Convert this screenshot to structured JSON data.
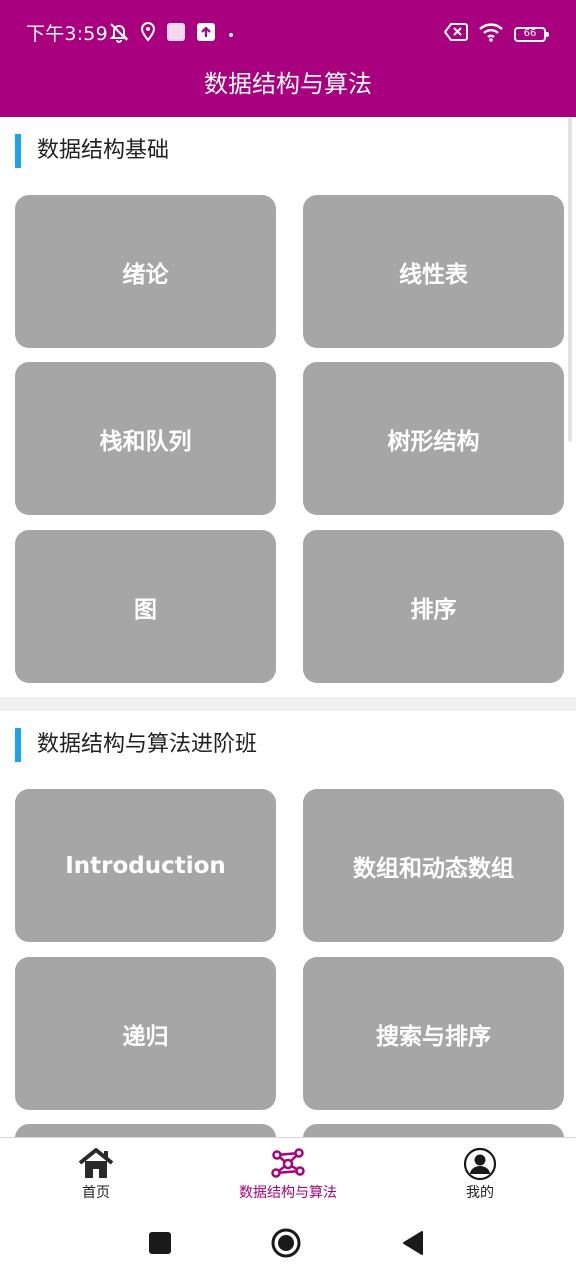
{
  "status_bar": {
    "time": "下午3:59",
    "battery": "66",
    "background": "#A8007E"
  },
  "title_bar": {
    "title": "数据结构与算法"
  },
  "sections": [
    {
      "title": "数据结构基础",
      "tiles": [
        "绪论",
        "线性表",
        "栈和队列",
        "树形结构",
        "图",
        "排序"
      ]
    },
    {
      "title": "数据结构与算法进阶班",
      "tiles": [
        "Introduction",
        "数组和动态数组",
        "递归",
        "搜索与排序"
      ]
    }
  ],
  "bottom_nav": {
    "items": [
      {
        "label": "首页",
        "icon": "home-icon"
      },
      {
        "label": "数据结构与算法",
        "icon": "network-icon",
        "active": true
      },
      {
        "label": "我的",
        "icon": "user-icon"
      }
    ],
    "active_color": "#A8007E"
  },
  "colors": {
    "accent_bar": "#1AA3EE",
    "tile": "#A6A6A6"
  }
}
